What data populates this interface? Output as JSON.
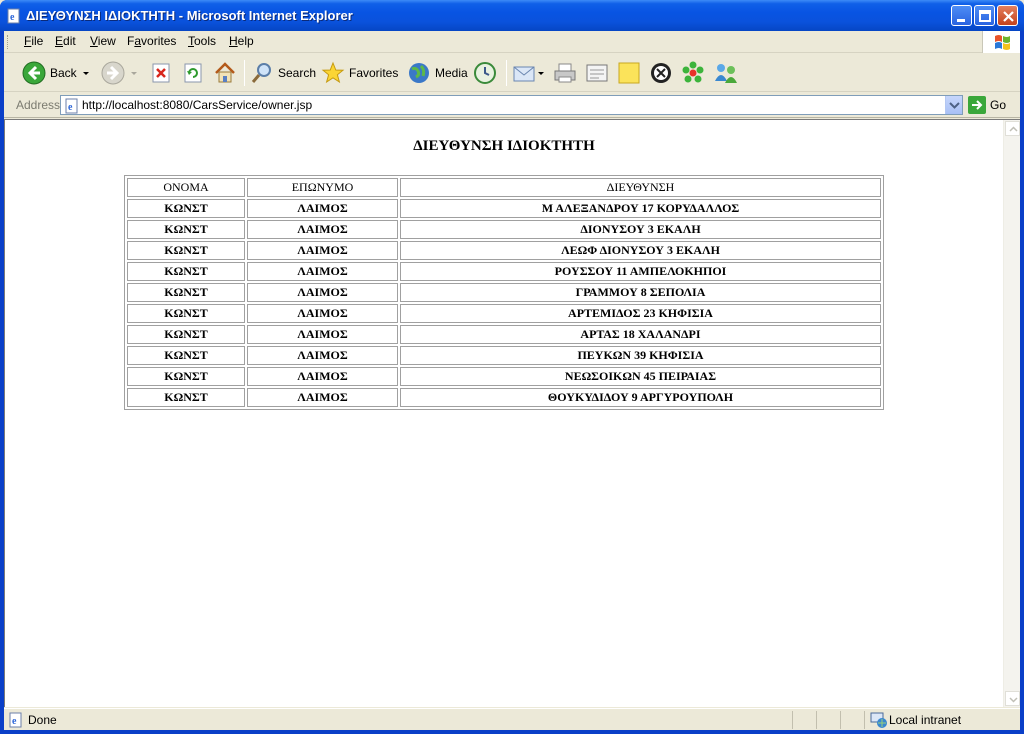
{
  "window": {
    "title": "ΔΙΕΥΘΥΝΣΗ ΙΔΙΟΚΤΗΤΗ - Microsoft Internet Explorer"
  },
  "menu": {
    "items": [
      {
        "underline": "F",
        "rest": "ile"
      },
      {
        "underline": "E",
        "rest": "dit"
      },
      {
        "underline": "V",
        "rest": "iew"
      },
      {
        "pre": "F",
        "underline": "a",
        "rest": "vorites"
      },
      {
        "underline": "T",
        "rest": "ools"
      },
      {
        "underline": "H",
        "rest": "elp"
      }
    ]
  },
  "toolbar": {
    "back_label": "Back",
    "search_label": "Search",
    "favorites_label": "Favorites",
    "media_label": "Media"
  },
  "address": {
    "label": "Address",
    "url": "http://localhost:8080/CarsService/owner.jsp",
    "go_label": "Go"
  },
  "page": {
    "heading": "ΔΙΕΥΘΥΝΣΗ ΙΔΙΟΚΤΗΤΗ",
    "columns": [
      "ΟΝΟΜΑ",
      "ΕΠΩΝΥΜΟ",
      "ΔΙΕΥΘΥΝΣΗ"
    ],
    "rows": [
      [
        "ΚΩΝΣΤ",
        "ΛΑΙΜΟΣ",
        "Μ ΑΛΕΞΑΝΔΡΟΥ 17 ΚΟΡΥΔΑΛΛΟΣ"
      ],
      [
        "ΚΩΝΣΤ",
        "ΛΑΙΜΟΣ",
        "ΔΙΟΝΥΣΟΥ 3 ΕΚΑΛΗ"
      ],
      [
        "ΚΩΝΣΤ",
        "ΛΑΙΜΟΣ",
        "ΛΕΩΦ ΔΙΟΝΥΣΟΥ 3 ΕΚΑΛΗ"
      ],
      [
        "ΚΩΝΣΤ",
        "ΛΑΙΜΟΣ",
        "ΡΟΥΣΣΟΥ 11 ΑΜΠΕΛΟΚΗΠΟΙ"
      ],
      [
        "ΚΩΝΣΤ",
        "ΛΑΙΜΟΣ",
        "ΓΡΑΜΜΟΥ 8 ΣΕΠΟΛΙΑ"
      ],
      [
        "ΚΩΝΣΤ",
        "ΛΑΙΜΟΣ",
        "ΑΡΤΕΜΙΔΟΣ 23 ΚΗΦΙΣΙΑ"
      ],
      [
        "ΚΩΝΣΤ",
        "ΛΑΙΜΟΣ",
        "ΑΡΤΑΣ 18 ΧΑΛΑΝΔΡΙ"
      ],
      [
        "ΚΩΝΣΤ",
        "ΛΑΙΜΟΣ",
        "ΠΕΥΚΩΝ 39 ΚΗΦΙΣΙΑ"
      ],
      [
        "ΚΩΝΣΤ",
        "ΛΑΙΜΟΣ",
        "ΝΕΩΣΟΙΚΩΝ 45 ΠΕΙΡΑΙΑΣ"
      ],
      [
        "ΚΩΝΣΤ",
        "ΛΑΙΜΟΣ",
        "ΘΟΥΚΥΔΙΔΟΥ 9 ΑΡΓΥΡΟΥΠΟΛΗ"
      ]
    ]
  },
  "status": {
    "text": "Done",
    "zone": "Local intranet"
  },
  "icons": {
    "window": "ie-page-icon",
    "back": "back-arrow-icon",
    "forward": "forward-arrow-icon",
    "stop": "stop-icon",
    "refresh": "refresh-icon",
    "home": "home-icon",
    "search": "search-magnifier-icon",
    "favorites": "favorites-star-icon",
    "media": "media-globe-icon",
    "history": "history-icon",
    "mail": "mail-icon",
    "print": "print-icon",
    "edit": "edit-icon",
    "discuss": "discuss-note-icon",
    "research": "research-icon",
    "icq": "icq-flower-icon",
    "messenger": "messenger-icon",
    "go": "go-arrow-icon",
    "zone": "local-intranet-icon"
  }
}
